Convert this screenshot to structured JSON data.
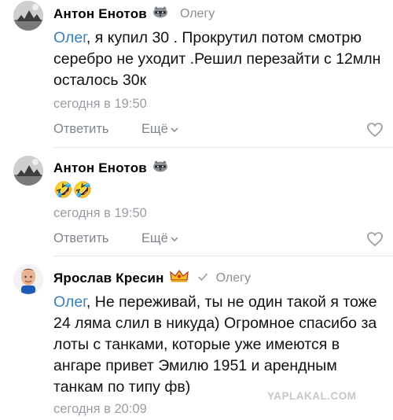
{
  "comments": [
    {
      "author": "Антон Енотов",
      "reply_to": "Олегу",
      "mention": "Олег",
      "text": ", я купил 30 . Прокрутил потом смотрю серебро не уходит .Решил перезайти с 12млн осталось 30к",
      "time": "сегодня в 19:50",
      "reply_label": "Ответить",
      "more_label": "Ещё"
    },
    {
      "author": "Антон Енотов",
      "emoji": "🤣🤣",
      "time": "сегодня в 19:50",
      "reply_label": "Ответить",
      "more_label": "Ещё"
    },
    {
      "author": "Ярослав Кресин",
      "reply_to": "Олегу",
      "mention": "Олег",
      "text": ", Не переживай, ты не один такой я тоже 24 ляма слил в никуда) Огромное спасибо за лоты с танками, которые уже имеются в ангаре привет Эмилю 1951 и арендным танкам по типу фв)",
      "time": "сегодня в 20:09"
    }
  ],
  "watermark": "YAPLAKAL.COM",
  "colors": {
    "mention": "#3a7fc4",
    "muted": "#9a9ea4",
    "action": "#7f858c"
  },
  "icons": {
    "raccoon_badge": "raccoon-icon",
    "crown_badge": "crown-icon",
    "reply_arrow": "checkmark-reply-icon",
    "like": "heart-icon",
    "more_chevron": "chevron-down-icon"
  }
}
